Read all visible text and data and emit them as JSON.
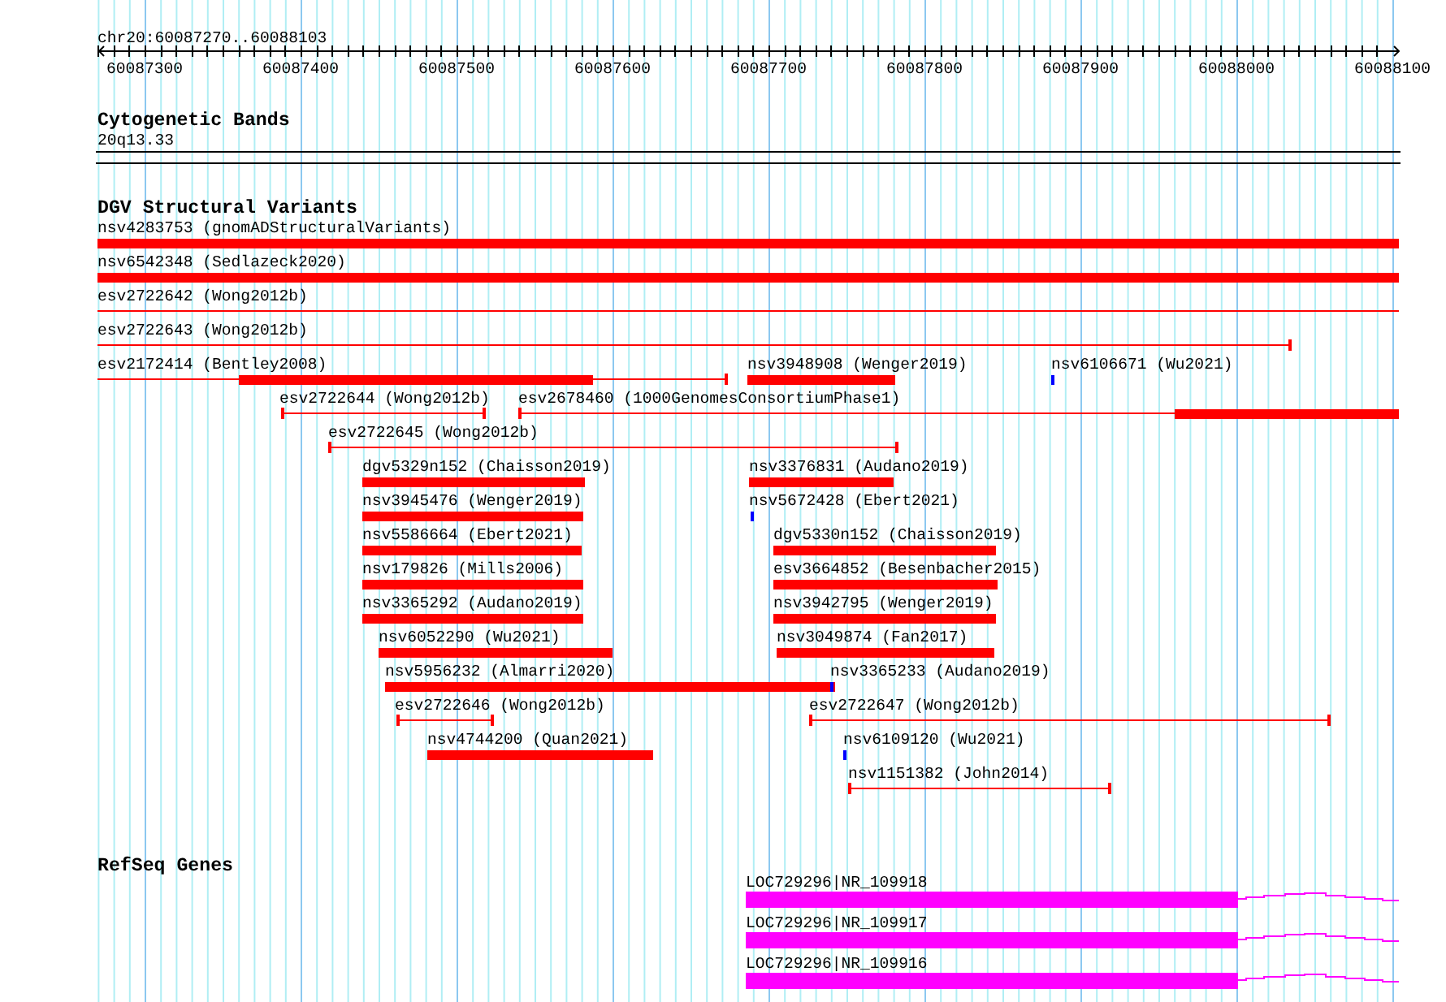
{
  "ruler": {
    "locus": "chr20:60087270..60088103",
    "ticks": [
      "60087300",
      "60087400",
      "60087500",
      "60087600",
      "60087700",
      "60087800",
      "60087900",
      "60088000",
      "60088100"
    ]
  },
  "cytogenetic_bands": {
    "title": "Cytogenetic Bands",
    "band": "20q13.33"
  },
  "dgv_structural_variants": {
    "title": "DGV Structural Variants",
    "variants": [
      {
        "label": "nsv4283753 (gnomADStructuralVariants)",
        "kind": "thick",
        "color": "#ff0000"
      },
      {
        "label": "nsv6542348 (Sedlazeck2020)",
        "kind": "thick",
        "color": "#ff0000"
      },
      {
        "label": "esv2722642 (Wong2012b)",
        "kind": "line",
        "color": "#ff0000"
      },
      {
        "label": "esv2722643 (Wong2012b)",
        "kind": "line",
        "color": "#ff0000"
      },
      {
        "label": "esv2172414 (Bentley2008)",
        "kind": "line-thick",
        "color": "#ff0000"
      },
      {
        "label": "nsv3948908 (Wenger2019)",
        "kind": "thick",
        "color": "#ff0000"
      },
      {
        "label": "nsv6106671 (Wu2021)",
        "kind": "point",
        "color": "#0000ff"
      },
      {
        "label": "esv2722644 (Wong2012b)",
        "kind": "line",
        "color": "#ff0000"
      },
      {
        "label": "esv2678460 (1000GenomesConsortiumPhase1)",
        "kind": "line-thick",
        "color": "#ff0000"
      },
      {
        "label": "esv2722645 (Wong2012b)",
        "kind": "line",
        "color": "#ff0000"
      },
      {
        "label": "dgv5329n152 (Chaisson2019)",
        "kind": "thick",
        "color": "#ff0000"
      },
      {
        "label": "nsv3376831 (Audano2019)",
        "kind": "thick",
        "color": "#ff0000"
      },
      {
        "label": "nsv3945476 (Wenger2019)",
        "kind": "thick",
        "color": "#ff0000"
      },
      {
        "label": "nsv5672428 (Ebert2021)",
        "kind": "point",
        "color": "#0000ff"
      },
      {
        "label": "nsv5586664 (Ebert2021)",
        "kind": "thick",
        "color": "#ff0000"
      },
      {
        "label": "dgv5330n152 (Chaisson2019)",
        "kind": "thick",
        "color": "#ff0000"
      },
      {
        "label": "nsv179826 (Mills2006)",
        "kind": "thick",
        "color": "#ff0000"
      },
      {
        "label": "esv3664852 (Besenbacher2015)",
        "kind": "thick",
        "color": "#ff0000"
      },
      {
        "label": "nsv3365292 (Audano2019)",
        "kind": "thick",
        "color": "#ff0000"
      },
      {
        "label": "nsv3942795 (Wenger2019)",
        "kind": "thick",
        "color": "#ff0000"
      },
      {
        "label": "nsv6052290 (Wu2021)",
        "kind": "thick",
        "color": "#ff0000"
      },
      {
        "label": "nsv3049874 (Fan2017)",
        "kind": "thick",
        "color": "#ff0000"
      },
      {
        "label": "nsv5956232 (Almarri2020)",
        "kind": "thick",
        "color": "#ff0000"
      },
      {
        "label": "nsv3365233 (Audano2019)",
        "kind": "point",
        "color": "#0000ff"
      },
      {
        "label": "esv2722646 (Wong2012b)",
        "kind": "line",
        "color": "#ff0000"
      },
      {
        "label": "esv2722647 (Wong2012b)",
        "kind": "line",
        "color": "#ff0000"
      },
      {
        "label": "nsv4744200 (Quan2021)",
        "kind": "thick",
        "color": "#ff0000"
      },
      {
        "label": "nsv6109120 (Wu2021)",
        "kind": "point",
        "color": "#0000ff"
      },
      {
        "label": "nsv1151382 (John2014)",
        "kind": "line",
        "color": "#ff0000"
      }
    ]
  },
  "refseq_genes": {
    "title": "RefSeq Genes",
    "genes": [
      {
        "label": "LOC729296|NR_109918"
      },
      {
        "label": "LOC729296|NR_109917"
      },
      {
        "label": "LOC729296|NR_109916"
      }
    ]
  }
}
